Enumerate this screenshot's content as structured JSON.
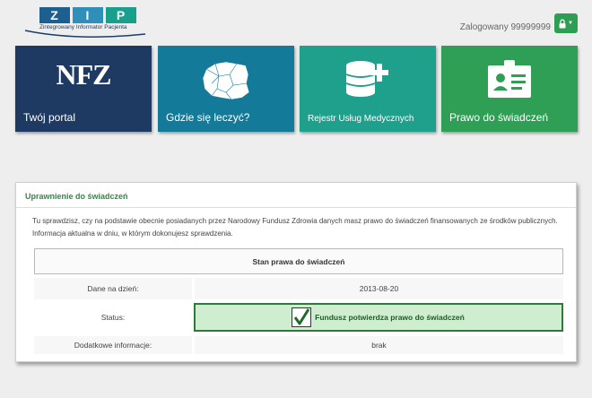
{
  "header": {
    "logo_letters": [
      "Z",
      "I",
      "P"
    ],
    "logo_subtitle": "Zintegrowany Informator Pacjenta",
    "login_text": "Zalogowany 99999999"
  },
  "tiles": [
    {
      "label": "Twój portal",
      "icon_text": "NFZ",
      "icon": "nfz-logo-icon"
    },
    {
      "label": "Gdzie się leczyć?",
      "icon": "poland-map-icon"
    },
    {
      "label": "Rejestr Usług Medycznych",
      "icon": "database-plus-icon"
    },
    {
      "label": "Prawo do świadczeń",
      "icon": "id-badge-icon"
    }
  ],
  "panel": {
    "title": "Uprawnienie do świadczeń",
    "description": "Tu sprawdzisz, czy na podstawie obecnie posiadanych przez Narodowy Fundusz Zdrowia danych masz prawo do świadczeń finansowanych ze środków publicznych. Informacja aktualna w dniu, w którym dokonujesz sprawdzenia.",
    "table_header": "Stan prawa do świadczeń",
    "rows": [
      {
        "label": "Dane na dzień:",
        "value": "2013-08-20"
      },
      {
        "label": "Status:",
        "value": "Fundusz potwierdza prawo do świadczeń"
      },
      {
        "label": "Dodatkowe informacje:",
        "value": "brak"
      }
    ]
  },
  "colors": {
    "tile_portal": "#1f3a62",
    "tile_map": "#137a9a",
    "tile_rum": "#1fa08c",
    "tile_rights": "#2f9f56",
    "status_bg": "#cfeecf",
    "status_border": "#2f7a3a",
    "title_green": "#2e8a43"
  }
}
